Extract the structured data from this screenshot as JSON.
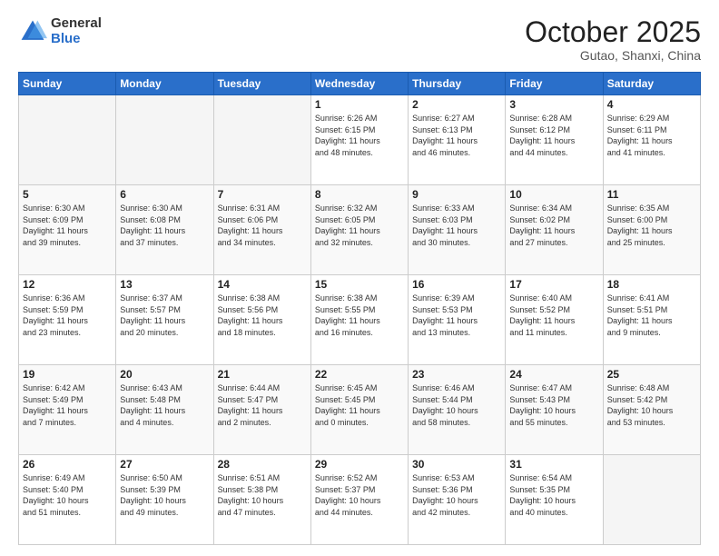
{
  "logo": {
    "general": "General",
    "blue": "Blue"
  },
  "header": {
    "month": "October 2025",
    "location": "Gutao, Shanxi, China"
  },
  "weekdays": [
    "Sunday",
    "Monday",
    "Tuesday",
    "Wednesday",
    "Thursday",
    "Friday",
    "Saturday"
  ],
  "weeks": [
    [
      {
        "day": "",
        "info": ""
      },
      {
        "day": "",
        "info": ""
      },
      {
        "day": "",
        "info": ""
      },
      {
        "day": "1",
        "info": "Sunrise: 6:26 AM\nSunset: 6:15 PM\nDaylight: 11 hours\nand 48 minutes."
      },
      {
        "day": "2",
        "info": "Sunrise: 6:27 AM\nSunset: 6:13 PM\nDaylight: 11 hours\nand 46 minutes."
      },
      {
        "day": "3",
        "info": "Sunrise: 6:28 AM\nSunset: 6:12 PM\nDaylight: 11 hours\nand 44 minutes."
      },
      {
        "day": "4",
        "info": "Sunrise: 6:29 AM\nSunset: 6:11 PM\nDaylight: 11 hours\nand 41 minutes."
      }
    ],
    [
      {
        "day": "5",
        "info": "Sunrise: 6:30 AM\nSunset: 6:09 PM\nDaylight: 11 hours\nand 39 minutes."
      },
      {
        "day": "6",
        "info": "Sunrise: 6:30 AM\nSunset: 6:08 PM\nDaylight: 11 hours\nand 37 minutes."
      },
      {
        "day": "7",
        "info": "Sunrise: 6:31 AM\nSunset: 6:06 PM\nDaylight: 11 hours\nand 34 minutes."
      },
      {
        "day": "8",
        "info": "Sunrise: 6:32 AM\nSunset: 6:05 PM\nDaylight: 11 hours\nand 32 minutes."
      },
      {
        "day": "9",
        "info": "Sunrise: 6:33 AM\nSunset: 6:03 PM\nDaylight: 11 hours\nand 30 minutes."
      },
      {
        "day": "10",
        "info": "Sunrise: 6:34 AM\nSunset: 6:02 PM\nDaylight: 11 hours\nand 27 minutes."
      },
      {
        "day": "11",
        "info": "Sunrise: 6:35 AM\nSunset: 6:00 PM\nDaylight: 11 hours\nand 25 minutes."
      }
    ],
    [
      {
        "day": "12",
        "info": "Sunrise: 6:36 AM\nSunset: 5:59 PM\nDaylight: 11 hours\nand 23 minutes."
      },
      {
        "day": "13",
        "info": "Sunrise: 6:37 AM\nSunset: 5:57 PM\nDaylight: 11 hours\nand 20 minutes."
      },
      {
        "day": "14",
        "info": "Sunrise: 6:38 AM\nSunset: 5:56 PM\nDaylight: 11 hours\nand 18 minutes."
      },
      {
        "day": "15",
        "info": "Sunrise: 6:38 AM\nSunset: 5:55 PM\nDaylight: 11 hours\nand 16 minutes."
      },
      {
        "day": "16",
        "info": "Sunrise: 6:39 AM\nSunset: 5:53 PM\nDaylight: 11 hours\nand 13 minutes."
      },
      {
        "day": "17",
        "info": "Sunrise: 6:40 AM\nSunset: 5:52 PM\nDaylight: 11 hours\nand 11 minutes."
      },
      {
        "day": "18",
        "info": "Sunrise: 6:41 AM\nSunset: 5:51 PM\nDaylight: 11 hours\nand 9 minutes."
      }
    ],
    [
      {
        "day": "19",
        "info": "Sunrise: 6:42 AM\nSunset: 5:49 PM\nDaylight: 11 hours\nand 7 minutes."
      },
      {
        "day": "20",
        "info": "Sunrise: 6:43 AM\nSunset: 5:48 PM\nDaylight: 11 hours\nand 4 minutes."
      },
      {
        "day": "21",
        "info": "Sunrise: 6:44 AM\nSunset: 5:47 PM\nDaylight: 11 hours\nand 2 minutes."
      },
      {
        "day": "22",
        "info": "Sunrise: 6:45 AM\nSunset: 5:45 PM\nDaylight: 11 hours\nand 0 minutes."
      },
      {
        "day": "23",
        "info": "Sunrise: 6:46 AM\nSunset: 5:44 PM\nDaylight: 10 hours\nand 58 minutes."
      },
      {
        "day": "24",
        "info": "Sunrise: 6:47 AM\nSunset: 5:43 PM\nDaylight: 10 hours\nand 55 minutes."
      },
      {
        "day": "25",
        "info": "Sunrise: 6:48 AM\nSunset: 5:42 PM\nDaylight: 10 hours\nand 53 minutes."
      }
    ],
    [
      {
        "day": "26",
        "info": "Sunrise: 6:49 AM\nSunset: 5:40 PM\nDaylight: 10 hours\nand 51 minutes."
      },
      {
        "day": "27",
        "info": "Sunrise: 6:50 AM\nSunset: 5:39 PM\nDaylight: 10 hours\nand 49 minutes."
      },
      {
        "day": "28",
        "info": "Sunrise: 6:51 AM\nSunset: 5:38 PM\nDaylight: 10 hours\nand 47 minutes."
      },
      {
        "day": "29",
        "info": "Sunrise: 6:52 AM\nSunset: 5:37 PM\nDaylight: 10 hours\nand 44 minutes."
      },
      {
        "day": "30",
        "info": "Sunrise: 6:53 AM\nSunset: 5:36 PM\nDaylight: 10 hours\nand 42 minutes."
      },
      {
        "day": "31",
        "info": "Sunrise: 6:54 AM\nSunset: 5:35 PM\nDaylight: 10 hours\nand 40 minutes."
      },
      {
        "day": "",
        "info": ""
      }
    ]
  ]
}
